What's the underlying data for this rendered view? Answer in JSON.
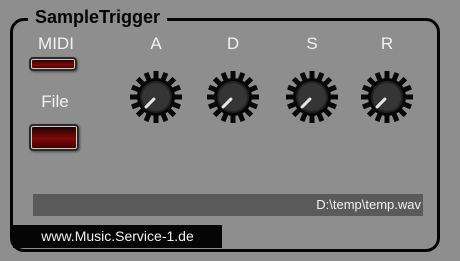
{
  "app": {
    "title": "SampleTrigger"
  },
  "midi": {
    "label": "MIDI",
    "led": "off"
  },
  "file": {
    "label": "File",
    "led": "off"
  },
  "knobs": [
    {
      "label": "A"
    },
    {
      "label": "D"
    },
    {
      "label": "S"
    },
    {
      "label": "R"
    }
  ],
  "file_path": "D:\\temp\\temp.wav",
  "footer": {
    "url": "www.Music.Service-1.de"
  },
  "colors": {
    "background": "#8e8e8e",
    "border": "#050505",
    "led_red": "#7e0a0a",
    "text": "#f2f2f2"
  }
}
